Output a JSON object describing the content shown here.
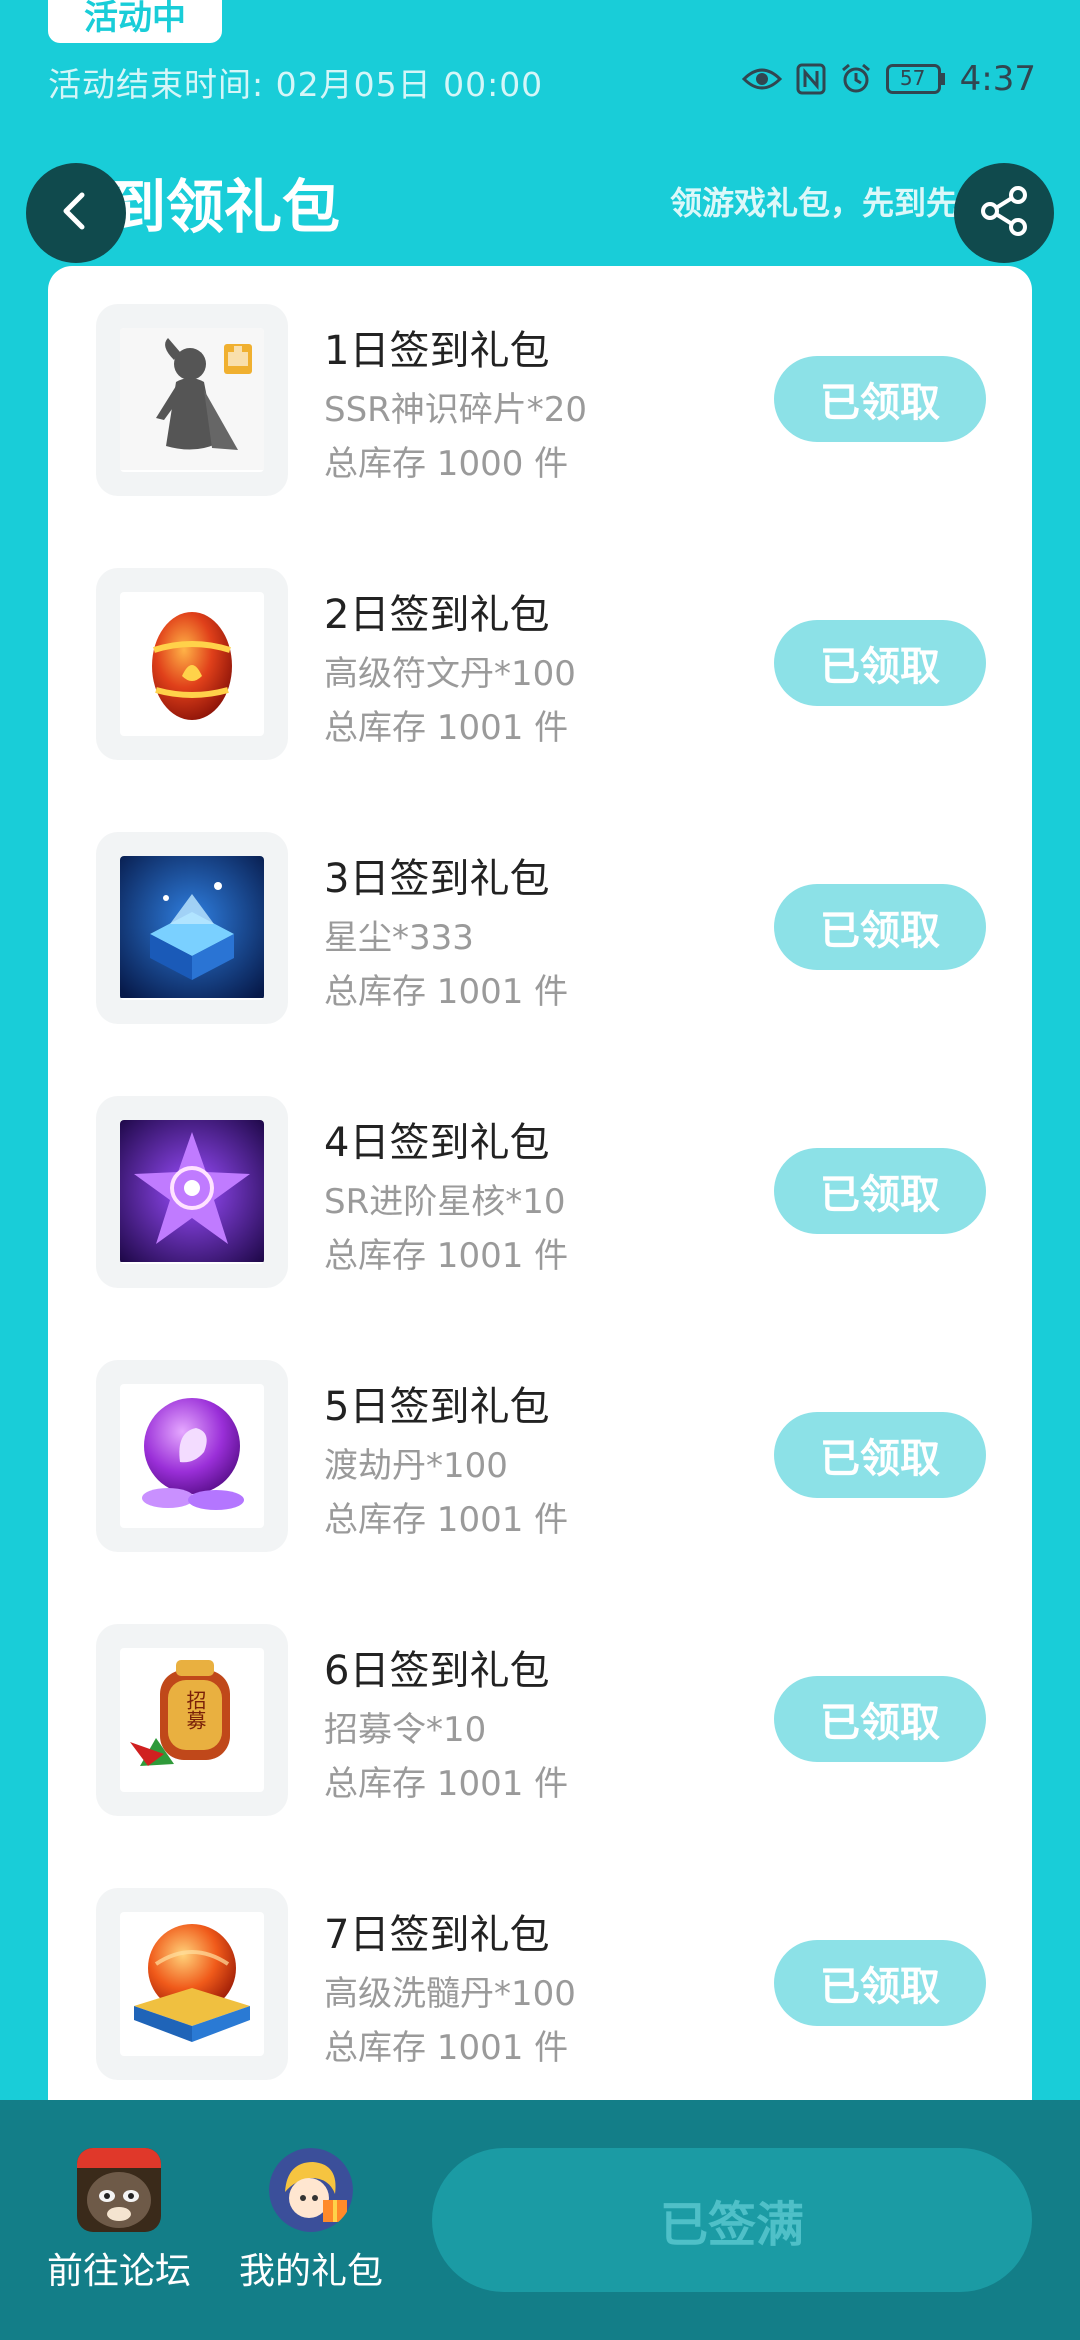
{
  "header": {
    "status_badge": "活动中",
    "end_time": "活动结束时间: 02月05日 00:00",
    "clock": "4:37",
    "battery": "57",
    "title": "签到领礼包",
    "subtitle": "领游戏礼包，先到先得",
    "icons": [
      "back-icon",
      "share-icon",
      "eye-icon",
      "nfc-icon",
      "alarm-icon",
      "battery-icon"
    ]
  },
  "gifts": [
    {
      "title": "1日签到礼包",
      "desc": "SSR神识碎片*20",
      "stock": "总库存 1000 件",
      "button": "已领取",
      "icon": "character-shard-icon"
    },
    {
      "title": "2日签到礼包",
      "desc": "高级符文丹*100",
      "stock": "总库存 1001 件",
      "button": "已领取",
      "icon": "red-egg-icon"
    },
    {
      "title": "3日签到礼包",
      "desc": "星尘*333",
      "stock": "总库存 1001 件",
      "button": "已领取",
      "icon": "blue-chest-icon"
    },
    {
      "title": "4日签到礼包",
      "desc": "SR进阶星核*10",
      "stock": "总库存 1001 件",
      "button": "已领取",
      "icon": "purple-star-icon"
    },
    {
      "title": "5日签到礼包",
      "desc": "渡劫丹*100",
      "stock": "总库存 1001 件",
      "button": "已领取",
      "icon": "purple-orb-icon"
    },
    {
      "title": "6日签到礼包",
      "desc": "招募令*10",
      "stock": "总库存 1001 件",
      "button": "已领取",
      "icon": "recruit-token-icon"
    },
    {
      "title": "7日签到礼包",
      "desc": "高级洗髓丹*100",
      "stock": "总库存 1001 件",
      "button": "已领取",
      "icon": "orange-orb-icon"
    }
  ],
  "recruit_token_glyph": "招募",
  "bottom": {
    "forum_label": "前往论坛",
    "my_gifts_label": "我的礼包",
    "signed_button": "已签满"
  },
  "colors": {
    "background": "#19cdd8",
    "claimed_button": "#8ce1e7",
    "bottom_bar": "#137e88"
  }
}
